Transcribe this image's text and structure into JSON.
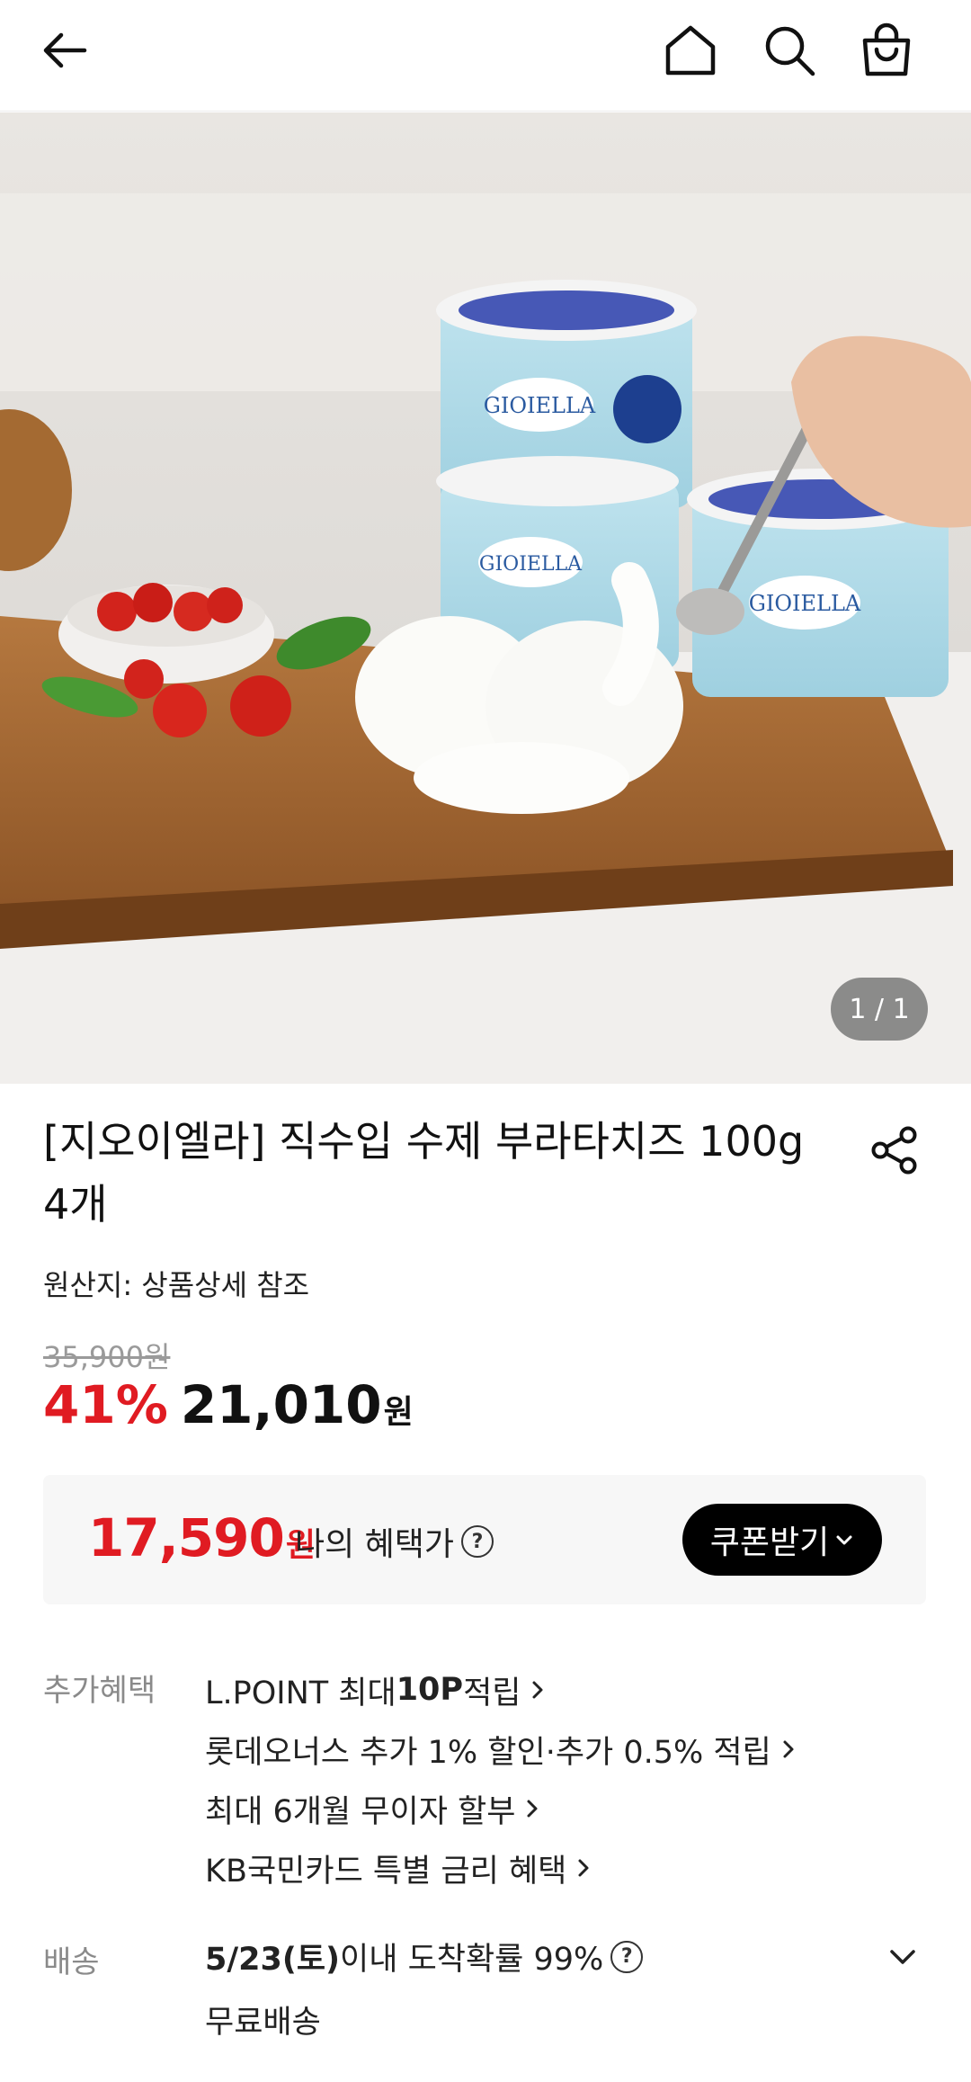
{
  "header": {
    "back_icon": "arrow-left-icon",
    "home_icon": "home-icon",
    "search_icon": "search-icon",
    "cart_icon": "shopping-bag-icon"
  },
  "gallery": {
    "counter": "1 / 1",
    "image_subject": "burrata cheese product photo"
  },
  "product": {
    "title": "[지오이엘라] 직수입 수제 부라타치즈 100g 4개",
    "origin": "원산지: 상품상세 참조",
    "original_price": "35,900원",
    "discount": "41%",
    "price": "21,010",
    "currency": "원"
  },
  "benefit_box": {
    "price": "17,590",
    "currency": "원",
    "label": "나의 혜택가",
    "help": "?",
    "coupon_button": "쿠폰받기"
  },
  "extra_benefits": {
    "label": "추가혜택",
    "items": [
      {
        "pre": "L.POINT 최대 ",
        "bold": "10P",
        "post": " 적립"
      },
      {
        "pre": "롯데오너스 추가 1% 할인·추가 0.5% 적립",
        "bold": "",
        "post": ""
      },
      {
        "pre": "최대 6개월 무이자 할부",
        "bold": "",
        "post": ""
      },
      {
        "pre": "KB국민카드 특별 금리 혜택",
        "bold": "",
        "post": ""
      }
    ]
  },
  "delivery": {
    "label": "배송",
    "date": "5/23(토)",
    "text": " 이내 도착확률 99%",
    "help": "?",
    "shipping": "무료배송"
  },
  "colors": {
    "accent_red": "#e01b22",
    "button_black": "#000000",
    "muted_gray": "#8a8a8a"
  }
}
